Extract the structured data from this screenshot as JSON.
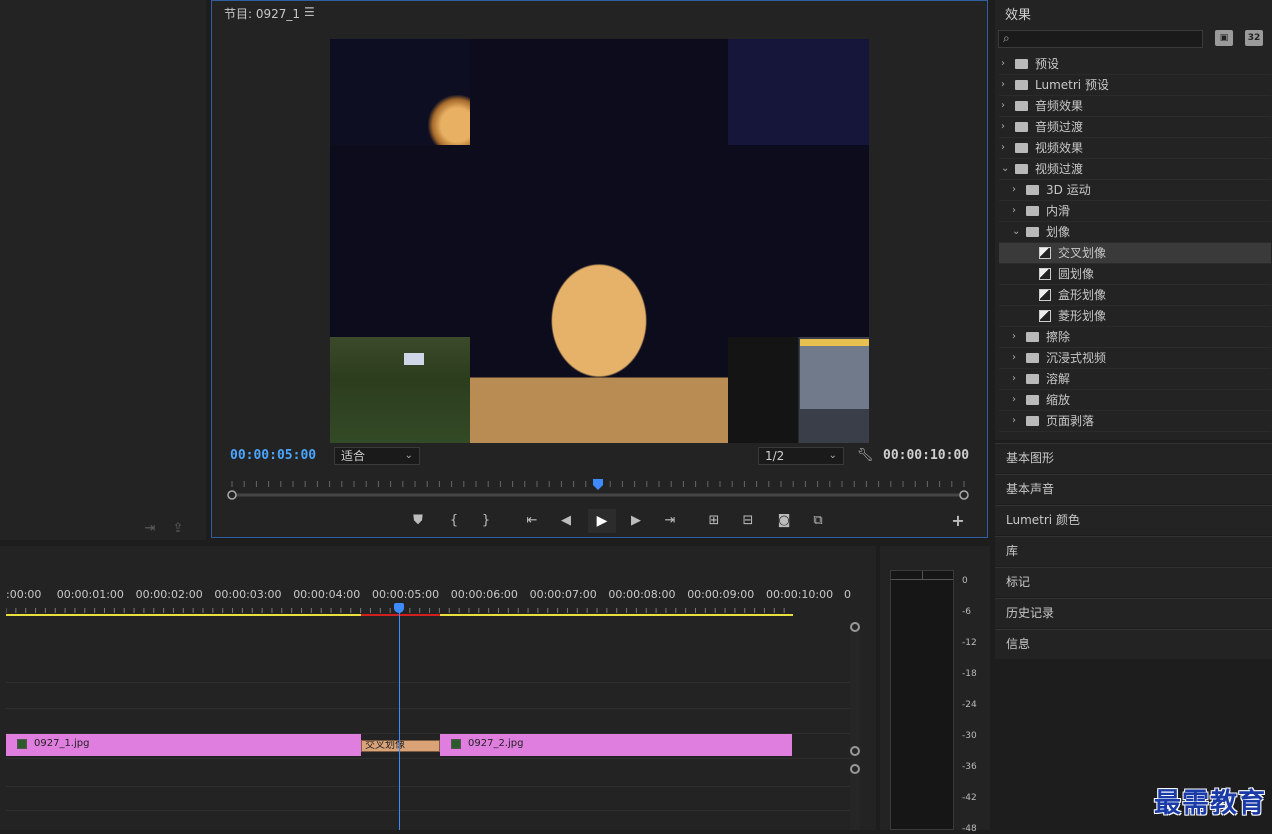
{
  "monitor": {
    "title": "节目: 0927_1",
    "menu_icon": "hamburger-icon",
    "timecode_current": "00:00:05:00",
    "timecode_duration": "00:00:10:00",
    "fit_label": "适合",
    "resolution_label": "1/2",
    "scrub_position": 0.5
  },
  "effects": {
    "title": "效果",
    "search_placeholder": "",
    "tree": [
      {
        "label": "预设",
        "depth": 0,
        "type": "preset-folder",
        "expanded": false
      },
      {
        "label": "Lumetri 预设",
        "depth": 0,
        "type": "preset-folder",
        "expanded": false
      },
      {
        "label": "音频效果",
        "depth": 0,
        "type": "folder",
        "expanded": false
      },
      {
        "label": "音频过渡",
        "depth": 0,
        "type": "folder",
        "expanded": false
      },
      {
        "label": "视频效果",
        "depth": 0,
        "type": "folder",
        "expanded": false
      },
      {
        "label": "视频过渡",
        "depth": 0,
        "type": "folder",
        "expanded": true
      },
      {
        "label": "3D 运动",
        "depth": 1,
        "type": "folder",
        "expanded": false
      },
      {
        "label": "内滑",
        "depth": 1,
        "type": "folder",
        "expanded": false
      },
      {
        "label": "划像",
        "depth": 1,
        "type": "folder",
        "expanded": true
      },
      {
        "label": "交叉划像",
        "depth": 2,
        "type": "effect",
        "selected": true
      },
      {
        "label": "圆划像",
        "depth": 2,
        "type": "effect"
      },
      {
        "label": "盒形划像",
        "depth": 2,
        "type": "effect"
      },
      {
        "label": "菱形划像",
        "depth": 2,
        "type": "effect"
      },
      {
        "label": "擦除",
        "depth": 1,
        "type": "folder",
        "expanded": false
      },
      {
        "label": "沉浸式视频",
        "depth": 1,
        "type": "folder",
        "expanded": false
      },
      {
        "label": "溶解",
        "depth": 1,
        "type": "folder",
        "expanded": false
      },
      {
        "label": "缩放",
        "depth": 1,
        "type": "folder",
        "expanded": false
      },
      {
        "label": "页面剥落",
        "depth": 1,
        "type": "folder",
        "expanded": false
      }
    ]
  },
  "panels": [
    "基本图形",
    "基本声音",
    "Lumetri 颜色",
    "库",
    "标记",
    "历史记录",
    "信息"
  ],
  "timeline": {
    "ruler_labels": [
      ":00:00",
      "00:00:01:00",
      "00:00:02:00",
      "00:00:03:00",
      "00:00:04:00",
      "00:00:05:00",
      "00:00:06:00",
      "00:00:07:00",
      "00:00:08:00",
      "00:00:09:00",
      "00:00:10:00",
      "0"
    ],
    "clips": [
      {
        "name": "0927_1.jpg",
        "color": "#e07ee0"
      },
      {
        "name": "0927_2.jpg",
        "color": "#e07ee0"
      }
    ],
    "transition": "交叉划像",
    "playhead": "00:00:05:00"
  },
  "meter": {
    "db_labels": [
      "0",
      "-6",
      "-12",
      "-18",
      "-24",
      "-30",
      "-36",
      "-42",
      "-48"
    ]
  },
  "watermark": "最需教育",
  "colors": {
    "accent": "#3d8bff",
    "clip": "#e07ee0",
    "transition": "#d9a277",
    "work_area": "#e8e040",
    "render_red": "#d02020"
  }
}
